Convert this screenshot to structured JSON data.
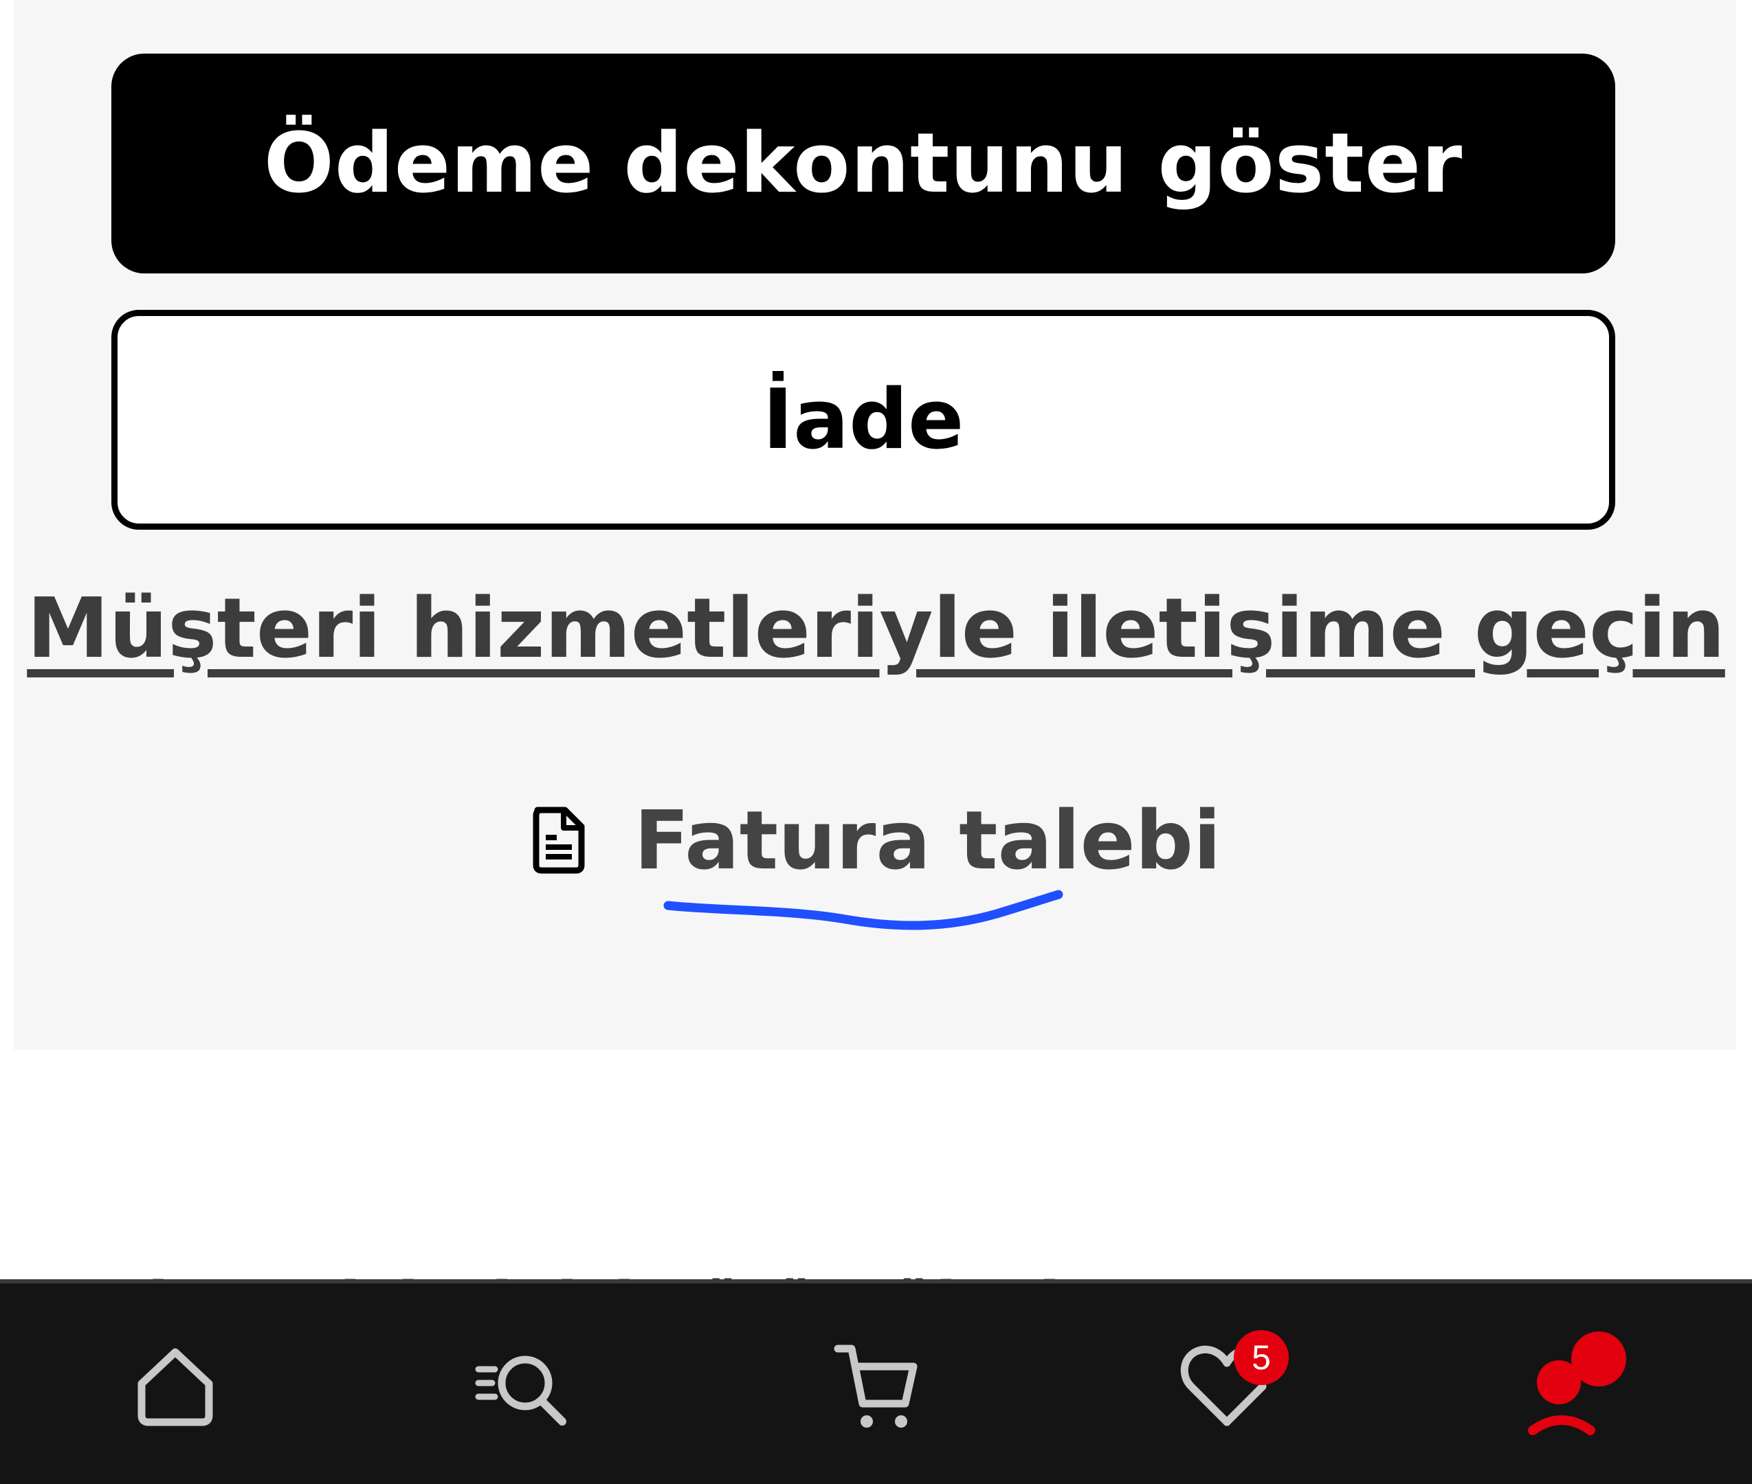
{
  "actions": {
    "show_receipt_label": "Ödeme dekontunu göster",
    "return_label": "İade",
    "contact_label": "Müşteri hizmetleriyle iletişime geçin",
    "invoice_label": "Fatura talebi"
  },
  "partially_hidden_text": "Alışverişlerinizi görüntüleyin",
  "bottom_nav": {
    "items": [
      {
        "name": "home",
        "icon": "home-icon"
      },
      {
        "name": "search",
        "icon": "search-icon"
      },
      {
        "name": "cart",
        "icon": "cart-icon"
      },
      {
        "name": "favorites",
        "icon": "heart-icon",
        "badge": "5"
      },
      {
        "name": "account",
        "icon": "account-icon",
        "active": true
      }
    ]
  },
  "colors": {
    "accent": "#e3000f",
    "primary_button": "#000000",
    "panel_background": "#f6f6f6",
    "nav_background": "#141414",
    "annotation": "#1f4fff"
  }
}
